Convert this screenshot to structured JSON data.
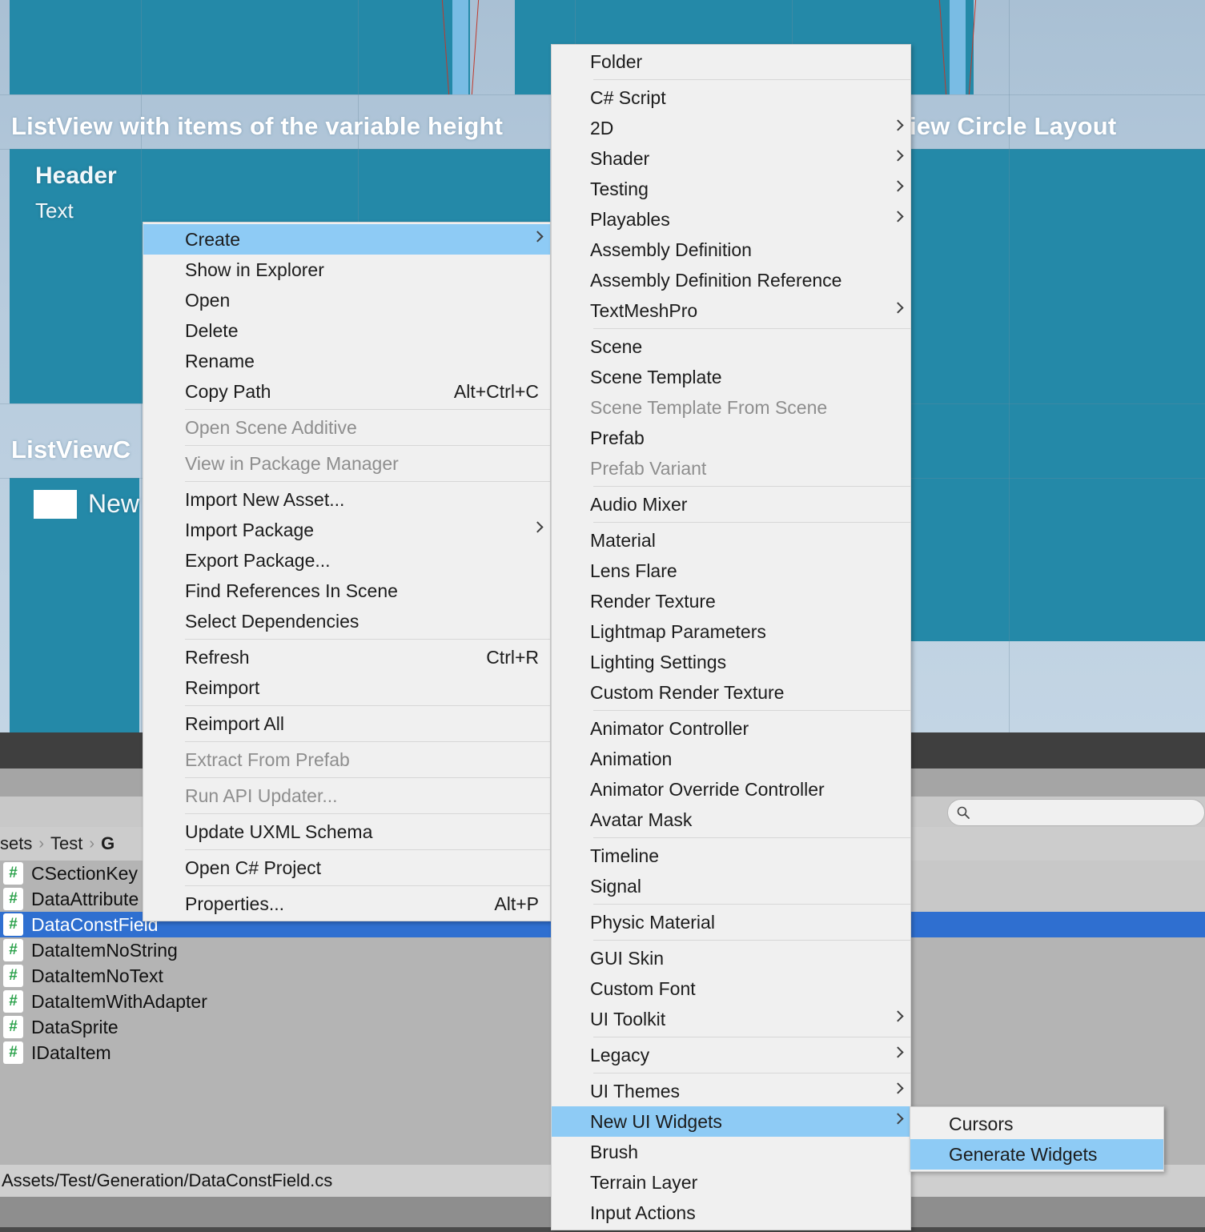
{
  "game_view": {
    "titles": [
      {
        "text": "ListView with items of the variable height"
      },
      {
        "text": "iew Circle Layout"
      },
      {
        "text": "ListViewC"
      }
    ],
    "labels": [
      {
        "text": "Header"
      },
      {
        "text": "Text"
      },
      {
        "text": "New"
      }
    ]
  },
  "project_browser": {
    "breadcrumb": [
      "sets",
      "Test",
      "G"
    ],
    "files": [
      {
        "name": "CSectionKey",
        "icon": "csharp-script-icon",
        "selected": false
      },
      {
        "name": "DataAttribute",
        "icon": "csharp-script-icon",
        "selected": false
      },
      {
        "name": "DataConstField",
        "icon": "csharp-script-icon",
        "selected": true
      },
      {
        "name": "DataItemNoString",
        "icon": "csharp-script-icon",
        "selected": false
      },
      {
        "name": "DataItemNoText",
        "icon": "csharp-script-icon",
        "selected": false
      },
      {
        "name": "DataItemWithAdapter",
        "icon": "csharp-script-icon",
        "selected": false
      },
      {
        "name": "DataSprite",
        "icon": "csharp-script-icon",
        "selected": false
      },
      {
        "name": "IDataItem",
        "icon": "csharp-script-icon",
        "selected": false
      }
    ],
    "status_path": "Assets/Test/Generation/DataConstField.cs",
    "icon_glyph": "#"
  },
  "right_panel": {
    "search_placeholder": "",
    "search_value": "",
    "search_icon": "search-icon"
  },
  "context_menu": {
    "items": [
      {
        "label": "Create",
        "shortcut": "",
        "submenu": true,
        "disabled": false,
        "highlighted": true,
        "sep_after": false
      },
      {
        "label": "Show in Explorer",
        "shortcut": "",
        "submenu": false,
        "disabled": false,
        "highlighted": false,
        "sep_after": false
      },
      {
        "label": "Open",
        "shortcut": "",
        "submenu": false,
        "disabled": false,
        "highlighted": false,
        "sep_after": false
      },
      {
        "label": "Delete",
        "shortcut": "",
        "submenu": false,
        "disabled": false,
        "highlighted": false,
        "sep_after": false
      },
      {
        "label": "Rename",
        "shortcut": "",
        "submenu": false,
        "disabled": false,
        "highlighted": false,
        "sep_after": false
      },
      {
        "label": "Copy Path",
        "shortcut": "Alt+Ctrl+C",
        "submenu": false,
        "disabled": false,
        "highlighted": false,
        "sep_after": true
      },
      {
        "label": "Open Scene Additive",
        "shortcut": "",
        "submenu": false,
        "disabled": true,
        "highlighted": false,
        "sep_after": true
      },
      {
        "label": "View in Package Manager",
        "shortcut": "",
        "submenu": false,
        "disabled": true,
        "highlighted": false,
        "sep_after": true
      },
      {
        "label": "Import New Asset...",
        "shortcut": "",
        "submenu": false,
        "disabled": false,
        "highlighted": false,
        "sep_after": false
      },
      {
        "label": "Import Package",
        "shortcut": "",
        "submenu": true,
        "disabled": false,
        "highlighted": false,
        "sep_after": false
      },
      {
        "label": "Export Package...",
        "shortcut": "",
        "submenu": false,
        "disabled": false,
        "highlighted": false,
        "sep_after": false
      },
      {
        "label": "Find References In Scene",
        "shortcut": "",
        "submenu": false,
        "disabled": false,
        "highlighted": false,
        "sep_after": false
      },
      {
        "label": "Select Dependencies",
        "shortcut": "",
        "submenu": false,
        "disabled": false,
        "highlighted": false,
        "sep_after": true
      },
      {
        "label": "Refresh",
        "shortcut": "Ctrl+R",
        "submenu": false,
        "disabled": false,
        "highlighted": false,
        "sep_after": false
      },
      {
        "label": "Reimport",
        "shortcut": "",
        "submenu": false,
        "disabled": false,
        "highlighted": false,
        "sep_after": true
      },
      {
        "label": "Reimport All",
        "shortcut": "",
        "submenu": false,
        "disabled": false,
        "highlighted": false,
        "sep_after": true
      },
      {
        "label": "Extract From Prefab",
        "shortcut": "",
        "submenu": false,
        "disabled": true,
        "highlighted": false,
        "sep_after": true
      },
      {
        "label": "Run API Updater...",
        "shortcut": "",
        "submenu": false,
        "disabled": true,
        "highlighted": false,
        "sep_after": true
      },
      {
        "label": "Update UXML Schema",
        "shortcut": "",
        "submenu": false,
        "disabled": false,
        "highlighted": false,
        "sep_after": true
      },
      {
        "label": "Open C# Project",
        "shortcut": "",
        "submenu": false,
        "disabled": false,
        "highlighted": false,
        "sep_after": true
      },
      {
        "label": "Properties...",
        "shortcut": "Alt+P",
        "submenu": false,
        "disabled": false,
        "highlighted": false,
        "sep_after": false
      }
    ]
  },
  "create_submenu": {
    "items": [
      {
        "label": "Folder",
        "submenu": false,
        "disabled": false,
        "highlighted": false,
        "sep_after": true
      },
      {
        "label": "C# Script",
        "submenu": false,
        "disabled": false,
        "highlighted": false,
        "sep_after": false
      },
      {
        "label": "2D",
        "submenu": true,
        "disabled": false,
        "highlighted": false,
        "sep_after": false
      },
      {
        "label": "Shader",
        "submenu": true,
        "disabled": false,
        "highlighted": false,
        "sep_after": false
      },
      {
        "label": "Testing",
        "submenu": true,
        "disabled": false,
        "highlighted": false,
        "sep_after": false
      },
      {
        "label": "Playables",
        "submenu": true,
        "disabled": false,
        "highlighted": false,
        "sep_after": false
      },
      {
        "label": "Assembly Definition",
        "submenu": false,
        "disabled": false,
        "highlighted": false,
        "sep_after": false
      },
      {
        "label": "Assembly Definition Reference",
        "submenu": false,
        "disabled": false,
        "highlighted": false,
        "sep_after": false
      },
      {
        "label": "TextMeshPro",
        "submenu": true,
        "disabled": false,
        "highlighted": false,
        "sep_after": true
      },
      {
        "label": "Scene",
        "submenu": false,
        "disabled": false,
        "highlighted": false,
        "sep_after": false
      },
      {
        "label": "Scene Template",
        "submenu": false,
        "disabled": false,
        "highlighted": false,
        "sep_after": false
      },
      {
        "label": "Scene Template From Scene",
        "submenu": false,
        "disabled": true,
        "highlighted": false,
        "sep_after": false
      },
      {
        "label": "Prefab",
        "submenu": false,
        "disabled": false,
        "highlighted": false,
        "sep_after": false
      },
      {
        "label": "Prefab Variant",
        "submenu": false,
        "disabled": true,
        "highlighted": false,
        "sep_after": true
      },
      {
        "label": "Audio Mixer",
        "submenu": false,
        "disabled": false,
        "highlighted": false,
        "sep_after": true
      },
      {
        "label": "Material",
        "submenu": false,
        "disabled": false,
        "highlighted": false,
        "sep_after": false
      },
      {
        "label": "Lens Flare",
        "submenu": false,
        "disabled": false,
        "highlighted": false,
        "sep_after": false
      },
      {
        "label": "Render Texture",
        "submenu": false,
        "disabled": false,
        "highlighted": false,
        "sep_after": false
      },
      {
        "label": "Lightmap Parameters",
        "submenu": false,
        "disabled": false,
        "highlighted": false,
        "sep_after": false
      },
      {
        "label": "Lighting Settings",
        "submenu": false,
        "disabled": false,
        "highlighted": false,
        "sep_after": false
      },
      {
        "label": "Custom Render Texture",
        "submenu": false,
        "disabled": false,
        "highlighted": false,
        "sep_after": true
      },
      {
        "label": "Animator Controller",
        "submenu": false,
        "disabled": false,
        "highlighted": false,
        "sep_after": false
      },
      {
        "label": "Animation",
        "submenu": false,
        "disabled": false,
        "highlighted": false,
        "sep_after": false
      },
      {
        "label": "Animator Override Controller",
        "submenu": false,
        "disabled": false,
        "highlighted": false,
        "sep_after": false
      },
      {
        "label": "Avatar Mask",
        "submenu": false,
        "disabled": false,
        "highlighted": false,
        "sep_after": true
      },
      {
        "label": "Timeline",
        "submenu": false,
        "disabled": false,
        "highlighted": false,
        "sep_after": false
      },
      {
        "label": "Signal",
        "submenu": false,
        "disabled": false,
        "highlighted": false,
        "sep_after": true
      },
      {
        "label": "Physic Material",
        "submenu": false,
        "disabled": false,
        "highlighted": false,
        "sep_after": true
      },
      {
        "label": "GUI Skin",
        "submenu": false,
        "disabled": false,
        "highlighted": false,
        "sep_after": false
      },
      {
        "label": "Custom Font",
        "submenu": false,
        "disabled": false,
        "highlighted": false,
        "sep_after": false
      },
      {
        "label": "UI Toolkit",
        "submenu": true,
        "disabled": false,
        "highlighted": false,
        "sep_after": true
      },
      {
        "label": "Legacy",
        "submenu": true,
        "disabled": false,
        "highlighted": false,
        "sep_after": true
      },
      {
        "label": "UI Themes",
        "submenu": true,
        "disabled": false,
        "highlighted": false,
        "sep_after": false
      },
      {
        "label": "New UI Widgets",
        "submenu": true,
        "disabled": false,
        "highlighted": true,
        "sep_after": false
      },
      {
        "label": "Brush",
        "submenu": false,
        "disabled": false,
        "highlighted": false,
        "sep_after": false
      },
      {
        "label": "Terrain Layer",
        "submenu": false,
        "disabled": false,
        "highlighted": false,
        "sep_after": false
      },
      {
        "label": "Input Actions",
        "submenu": false,
        "disabled": false,
        "highlighted": false,
        "sep_after": false
      }
    ]
  },
  "widgets_submenu": {
    "items": [
      {
        "label": "Cursors",
        "submenu": false,
        "disabled": false,
        "highlighted": false,
        "sep_after": false
      },
      {
        "label": "Generate Widgets",
        "submenu": false,
        "disabled": false,
        "highlighted": true,
        "sep_after": false
      }
    ]
  },
  "colors": {
    "menu_bg": "#f0f0f0",
    "menu_highlight": "#8ecbf5",
    "menu_text": "#1c1c1c",
    "menu_disabled_text": "#8e8e8e",
    "teal_panel": "#2489a8",
    "selection_blue": "#2f6fd0",
    "spike_blue": "#79bce4",
    "spike_outline": "#c0392b"
  }
}
